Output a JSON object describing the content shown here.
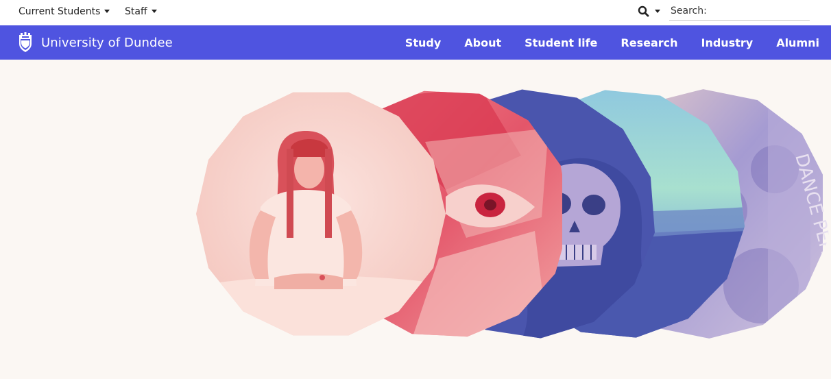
{
  "utility_bar": {
    "current_students_label": "Current Students",
    "staff_label": "Staff",
    "search": {
      "placeholder": "Search:",
      "value": ""
    }
  },
  "main_nav": {
    "brand_name": "University of Dundee",
    "items": [
      {
        "label": "Study"
      },
      {
        "label": "About"
      },
      {
        "label": "Student life"
      },
      {
        "label": "Research"
      },
      {
        "label": "Industry"
      },
      {
        "label": "Alumni"
      }
    ]
  },
  "hero": {
    "artwork_text": "DANCE  PERSPECT"
  },
  "colors": {
    "nav_bg": "#4f54e0",
    "hero_bg": "#fbf7f3",
    "pink_tint": "#f6c9c1",
    "coral": "#e4566a",
    "indigo": "#4a55ad",
    "mint": "#a6dfcf",
    "lavender": "#a39ad0"
  },
  "icons": {
    "search": "search-icon",
    "brand_crest": "crest-icon",
    "dropdown": "caret-down-icon"
  }
}
